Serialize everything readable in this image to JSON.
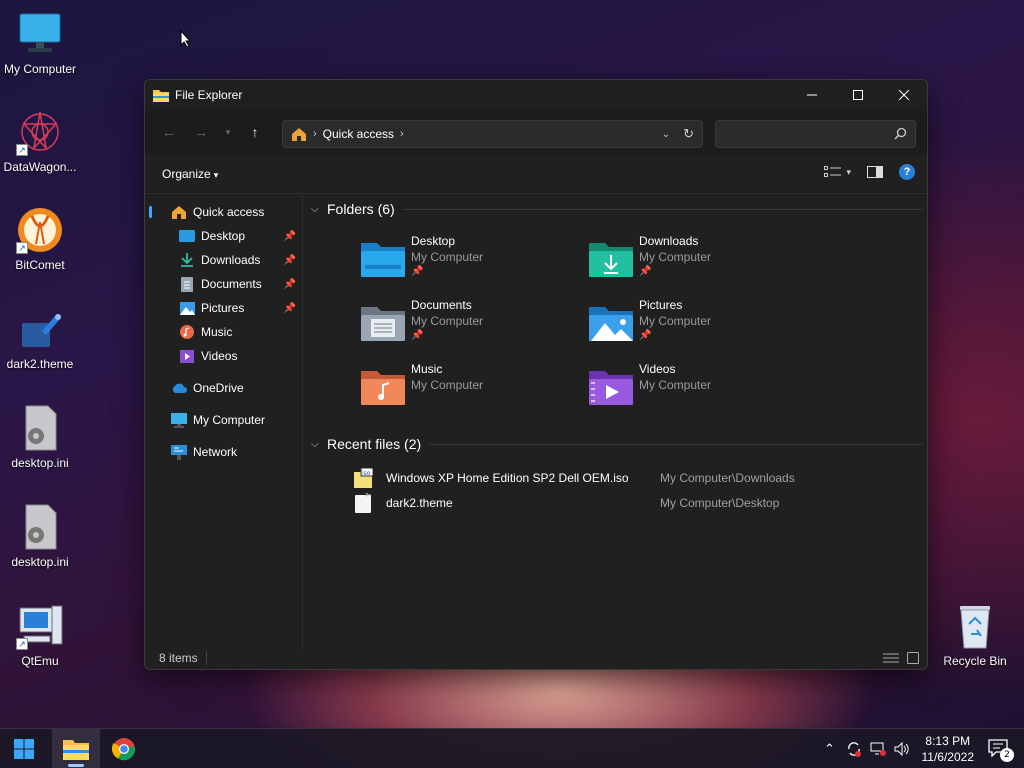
{
  "desktop": {
    "icons": [
      {
        "label": "My Computer",
        "icon": "monitor-icon"
      },
      {
        "label": "DataWagon...",
        "icon": "datawagon-icon"
      },
      {
        "label": "BitComet",
        "icon": "bitcomet-icon"
      },
      {
        "label": "dark2.theme",
        "icon": "theme-file-icon"
      },
      {
        "label": "desktop.ini",
        "icon": "settings-file-icon"
      },
      {
        "label": "desktop.ini",
        "icon": "settings-file-icon"
      },
      {
        "label": "QtEmu",
        "icon": "qtemu-icon"
      },
      {
        "label": "Recycle Bin",
        "icon": "recycle-bin-icon"
      }
    ]
  },
  "window": {
    "title": "File Explorer",
    "address": {
      "location": "Quick access"
    },
    "search": {
      "placeholder": ""
    },
    "commandbar": {
      "organize_label": "Organize"
    },
    "sidebar": {
      "items": [
        {
          "label": "Quick access",
          "icon": "star-home-icon",
          "pinned": false
        },
        {
          "label": "Desktop",
          "icon": "desktop-icon",
          "pinned": true
        },
        {
          "label": "Downloads",
          "icon": "download-icon",
          "pinned": true
        },
        {
          "label": "Documents",
          "icon": "document-icon",
          "pinned": true
        },
        {
          "label": "Pictures",
          "icon": "pictures-icon",
          "pinned": true
        },
        {
          "label": "Music",
          "icon": "music-icon",
          "pinned": false
        },
        {
          "label": "Videos",
          "icon": "videos-icon",
          "pinned": false
        },
        {
          "label": "OneDrive",
          "icon": "cloud-icon",
          "pinned": false
        },
        {
          "label": "My Computer",
          "icon": "computer-icon",
          "pinned": false
        },
        {
          "label": "Network",
          "icon": "network-icon",
          "pinned": false
        }
      ]
    },
    "folders_header": "Folders (6)",
    "folders": [
      {
        "name": "Desktop",
        "location": "My Computer",
        "pinned": true,
        "color": "#1e90d6"
      },
      {
        "name": "Downloads",
        "location": "My Computer",
        "pinned": true,
        "color": "#1aa88c"
      },
      {
        "name": "Documents",
        "location": "My Computer",
        "pinned": true,
        "color": "#7d8a99"
      },
      {
        "name": "Pictures",
        "location": "My Computer",
        "pinned": true,
        "color": "#2a8fd8"
      },
      {
        "name": "Music",
        "location": "My Computer",
        "pinned": false,
        "color": "#e8734a"
      },
      {
        "name": "Videos",
        "location": "My Computer",
        "pinned": false,
        "color": "#8a4fd0"
      }
    ],
    "pin_glyph": "📌",
    "recent_header": "Recent files (2)",
    "recent_files": [
      {
        "name": "Windows XP Home Edition SP2 Dell OEM.iso",
        "location": "My Computer\\Downloads",
        "icon": "iso-file-icon"
      },
      {
        "name": "dark2.theme",
        "location": "My Computer\\Desktop",
        "icon": "theme-file-icon"
      }
    ],
    "status": {
      "item_count": "8 items"
    }
  },
  "taskbar": {
    "time": "8:13 PM",
    "date": "11/6/2022",
    "notification_count": "2"
  }
}
